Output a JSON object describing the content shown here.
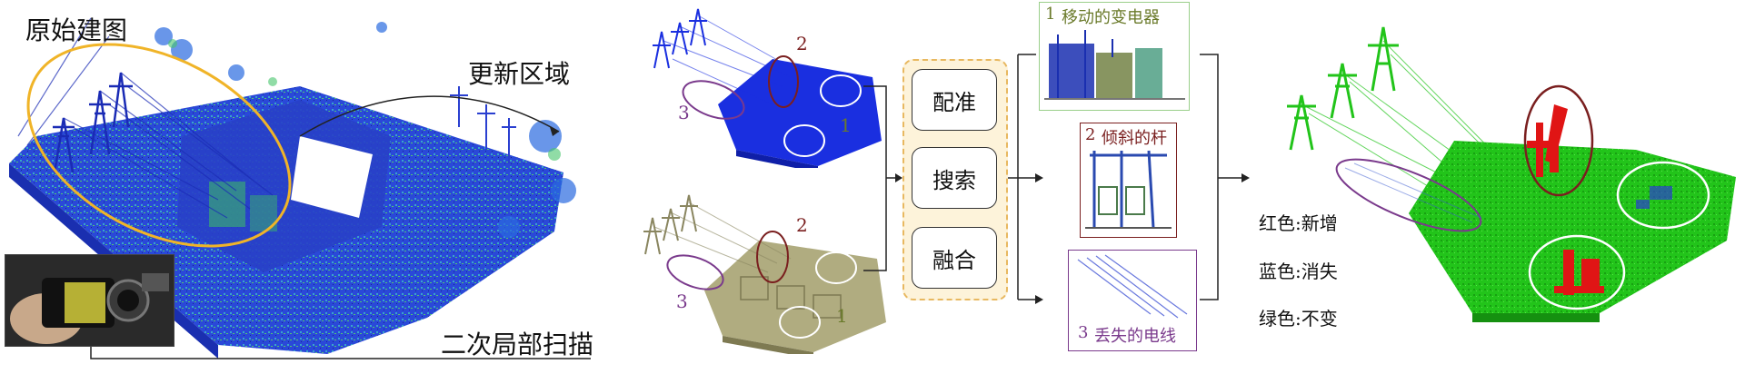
{
  "labels": {
    "original_map": "原始建图",
    "update_region": "更新区域",
    "secondary_scan": "二次局部扫描"
  },
  "region_markers": {
    "top": {
      "m1": "1",
      "m2": "2",
      "m3": "3"
    },
    "bottom": {
      "m1": "1",
      "m2": "2",
      "m3": "3"
    }
  },
  "process_steps": [
    "配准",
    "搜索",
    "融合"
  ],
  "change_panels": {
    "p1": {
      "num": "1",
      "text": "移动的变电器"
    },
    "p2": {
      "num": "2",
      "text": "倾斜的杆"
    },
    "p3": {
      "num": "3",
      "text": "丢失的电线"
    }
  },
  "legend": [
    "红色:新增",
    "蓝色:消失",
    "绿色:不变"
  ],
  "colors": {
    "original_blue": "#1f3fd6",
    "scan_khaki": "#9a9668",
    "unchanged_green": "#22c41a",
    "added_red": "#e01515",
    "ellipse_orange": "#f0b428",
    "ellipse_brown": "#7a1f1f",
    "ellipse_purple": "#7a3a8c",
    "process_bg": "#fdf3da",
    "process_border": "#e8b860"
  }
}
